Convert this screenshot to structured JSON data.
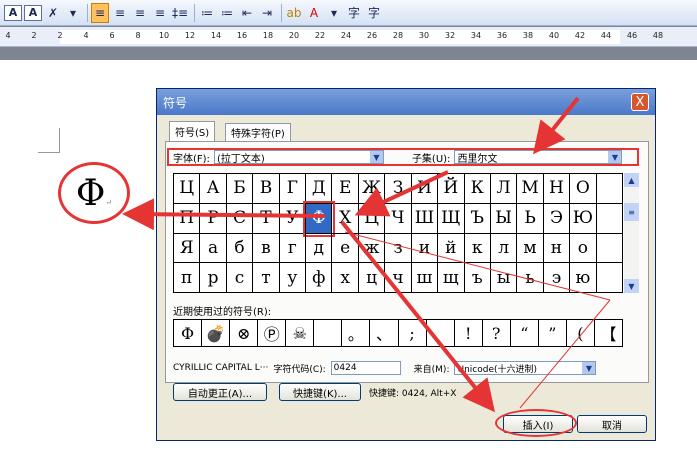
{
  "toolbar": {
    "items": [
      "A",
      "A",
      "✗",
      "▾",
      "≡",
      "≡",
      "≡",
      "≡",
      "‡≡",
      "≔",
      "≔",
      "⇤",
      "⇥",
      "ab",
      "A",
      "▾",
      "字",
      "字"
    ]
  },
  "ruler": {
    "ticks": [
      "4",
      "2",
      "2",
      "4",
      "6",
      "8",
      "10",
      "12",
      "14",
      "16",
      "18",
      "20",
      "22",
      "24",
      "26",
      "28",
      "30",
      "32",
      "34",
      "36",
      "38",
      "40",
      "42",
      "44",
      "46",
      "48"
    ]
  },
  "document": {
    "symbol": "Φ",
    "cursor_mark": "↵"
  },
  "dialog": {
    "title": "符号",
    "close": "X",
    "tabs": [
      "符号(S)",
      "特殊字符(P)"
    ],
    "font_label": "字体(F):",
    "font_value": "(拉丁文本)",
    "subset_label": "子集(U):",
    "subset_value": "西里尔文",
    "grid": [
      [
        "Ц",
        "А",
        "Б",
        "В",
        "Г",
        "Д",
        "Е",
        "Ж",
        "З",
        "И",
        "Й",
        "К",
        "Л",
        "М",
        "Н",
        "О",
        ""
      ],
      [
        "П",
        "Р",
        "С",
        "Т",
        "У",
        "Ф",
        "Х",
        "Ц",
        "Ч",
        "Ш",
        "Щ",
        "Ъ",
        "Ы",
        "Ь",
        "Э",
        "Ю",
        ""
      ],
      [
        "Я",
        "а",
        "б",
        "в",
        "г",
        "д",
        "е",
        "ж",
        "з",
        "и",
        "й",
        "к",
        "л",
        "м",
        "н",
        "о",
        ""
      ],
      [
        "п",
        "р",
        "с",
        "т",
        "у",
        "ф",
        "х",
        "ц",
        "ч",
        "ш",
        "щ",
        "ъ",
        "ы",
        "ь",
        "э",
        "ю",
        ""
      ]
    ],
    "recent_label": "近期使用过的符号(R):",
    "recent": [
      "Φ",
      "💣",
      "⊗",
      "Ⓟ",
      "☠",
      "",
      "。",
      "、",
      ";",
      "",
      "!",
      "?",
      "“",
      "”",
      "(",
      "【"
    ],
    "char_name": "CYRILLIC CAPITAL L···",
    "code_label": "字符代码(C):",
    "code_value": "0424",
    "from_label": "来自(M):",
    "from_value": "Unicode(十六进制)",
    "autocorrect_button": "自动更正(A)...",
    "shortcut_button": "快捷键(K)...",
    "shortcut_text": "快捷键: 0424, Alt+X",
    "insert_button": "插入(I)",
    "cancel_button": "取消"
  },
  "colors": {
    "accent": "#e53434",
    "selection": "#316ac5"
  }
}
